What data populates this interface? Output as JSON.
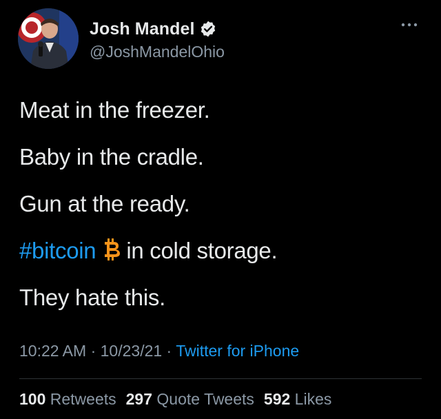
{
  "author": {
    "display_name": "Josh Mandel",
    "handle": "@JoshMandelOhio",
    "verified": true,
    "avatar_icon": "profile-photo"
  },
  "tweet": {
    "lines": [
      "Meat in the freezer.",
      "Baby in the cradle.",
      "Gun at the ready."
    ],
    "bitcoin_line": {
      "hashtag": "#bitcoin",
      "icon": "bitcoin-icon",
      "rest": "in cold storage."
    },
    "last_line": "They hate this."
  },
  "meta": {
    "time": "10:22 AM",
    "sep1": " · ",
    "date": "10/23/21",
    "sep2": " · ",
    "source": "Twitter for iPhone"
  },
  "stats": {
    "retweets_count": "100",
    "retweets_label": "Retweets",
    "quote_count": "297",
    "quote_label": "Quote Tweets",
    "likes_count": "592",
    "likes_label": "Likes"
  },
  "colors": {
    "background": "#000000",
    "text": "#e7e9ea",
    "secondary": "#8b98a5",
    "accent": "#1d9bf0",
    "bitcoin": "#f7931a"
  }
}
